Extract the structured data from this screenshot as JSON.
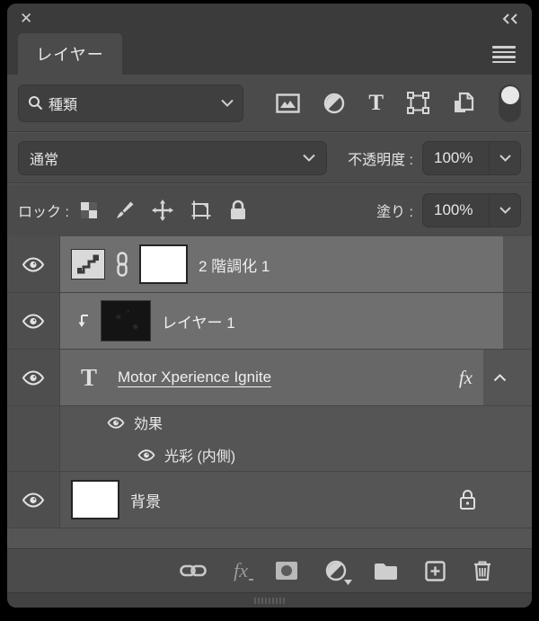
{
  "window": {
    "close_glyph": "✕",
    "collapse_icon": "double-chevron-left",
    "menu_icon": "hamburger-menu"
  },
  "tab": {
    "label": "レイヤー"
  },
  "filter_bar": {
    "search_value": "種類",
    "icons": [
      "search-icon",
      "chevron-down-icon",
      "pixel-layer-filter-icon",
      "adjustment-layer-filter-icon",
      "type-layer-filter-icon",
      "shape-layer-filter-icon",
      "smart-object-filter-icon",
      "filter-toggle-on"
    ],
    "type_glyph": "T"
  },
  "blend_bar": {
    "mode_value": "通常",
    "opacity_label": "不透明度 :",
    "opacity_value": "100%"
  },
  "lock_bar": {
    "label": "ロック :",
    "icons": [
      "lock-transparency-icon",
      "lock-pixels-brush-icon",
      "lock-position-icon",
      "lock-artboard-icon",
      "lock-all-icon"
    ],
    "fill_label": "塗り :",
    "fill_value": "100%"
  },
  "layers": [
    {
      "name": "2 階調化 1",
      "type": "threshold-adjustment",
      "visible": true,
      "mask": "white",
      "linked": true
    },
    {
      "name": "レイヤー 1",
      "type": "image",
      "visible": true,
      "clipped": true
    },
    {
      "name": "Motor Xperience Ignite",
      "type": "text",
      "visible": true,
      "has_effects": true,
      "fx_label": "fx",
      "type_glyph": "T"
    },
    {
      "name": "背景",
      "type": "background",
      "visible": true,
      "locked": true
    }
  ],
  "effects": {
    "group_label": "効果",
    "items": [
      {
        "name": "光彩 (内側)"
      }
    ]
  },
  "bottom_toolbar": {
    "fx_label": "fx",
    "icons": [
      "link-layers-icon",
      "layer-style-fx-icon",
      "add-layer-mask-icon",
      "new-adjustment-layer-icon",
      "new-group-folder-icon",
      "new-layer-icon",
      "delete-layer-trash-icon"
    ]
  },
  "colors": {
    "panel_bg": "#4b4b4b",
    "topbar_bg": "#3b3b3b",
    "list_bg": "#555555",
    "row_highlight": "#6f6f6f",
    "field_bg": "#3f3f3f",
    "text": "#e8e8e8"
  }
}
